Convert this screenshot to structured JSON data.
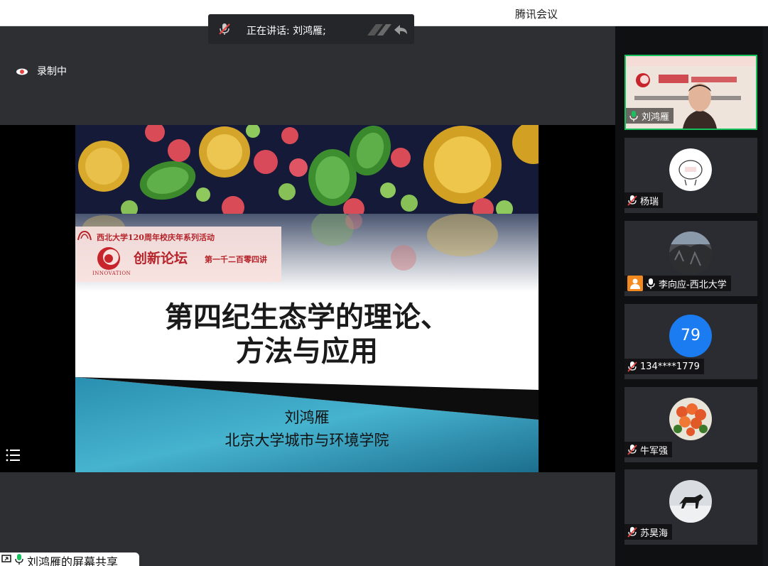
{
  "app": {
    "title": "腾讯会议"
  },
  "recording": {
    "label": "录制中"
  },
  "speaker_bar": {
    "label": "正在讲话: 刘鸿雁;"
  },
  "slide": {
    "series": "西北大学120周年校庆年系列活动",
    "forum": "创新论坛",
    "lecture": "第一千二百零四讲",
    "innovation": "INNOVATION",
    "title_line1": "第四纪生态学的理论、",
    "title_line2": "方法与应用",
    "author": "刘鸿雁",
    "affiliation": "北京大学城市与环境学院"
  },
  "share_bar": {
    "label": "刘鸿雁的屏幕共享"
  },
  "participants": [
    {
      "name": "刘鸿雁",
      "mic": "on",
      "active": true
    },
    {
      "name": "杨瑞",
      "mic": "muted",
      "avatar": "text-avatar"
    },
    {
      "name": "李向应-西北大学",
      "mic": "on",
      "avatar": "photo"
    },
    {
      "name": "134****1779",
      "mic": "muted",
      "avatar_number": "79"
    },
    {
      "name": "牛军强",
      "mic": "muted",
      "avatar": "flowers"
    },
    {
      "name": "苏昊海",
      "mic": "muted",
      "avatar": "horse"
    }
  ],
  "colors": {
    "active_border": "#17c25e",
    "number_avatar": "#1b7bf0",
    "accent_red": "#b6242b"
  }
}
